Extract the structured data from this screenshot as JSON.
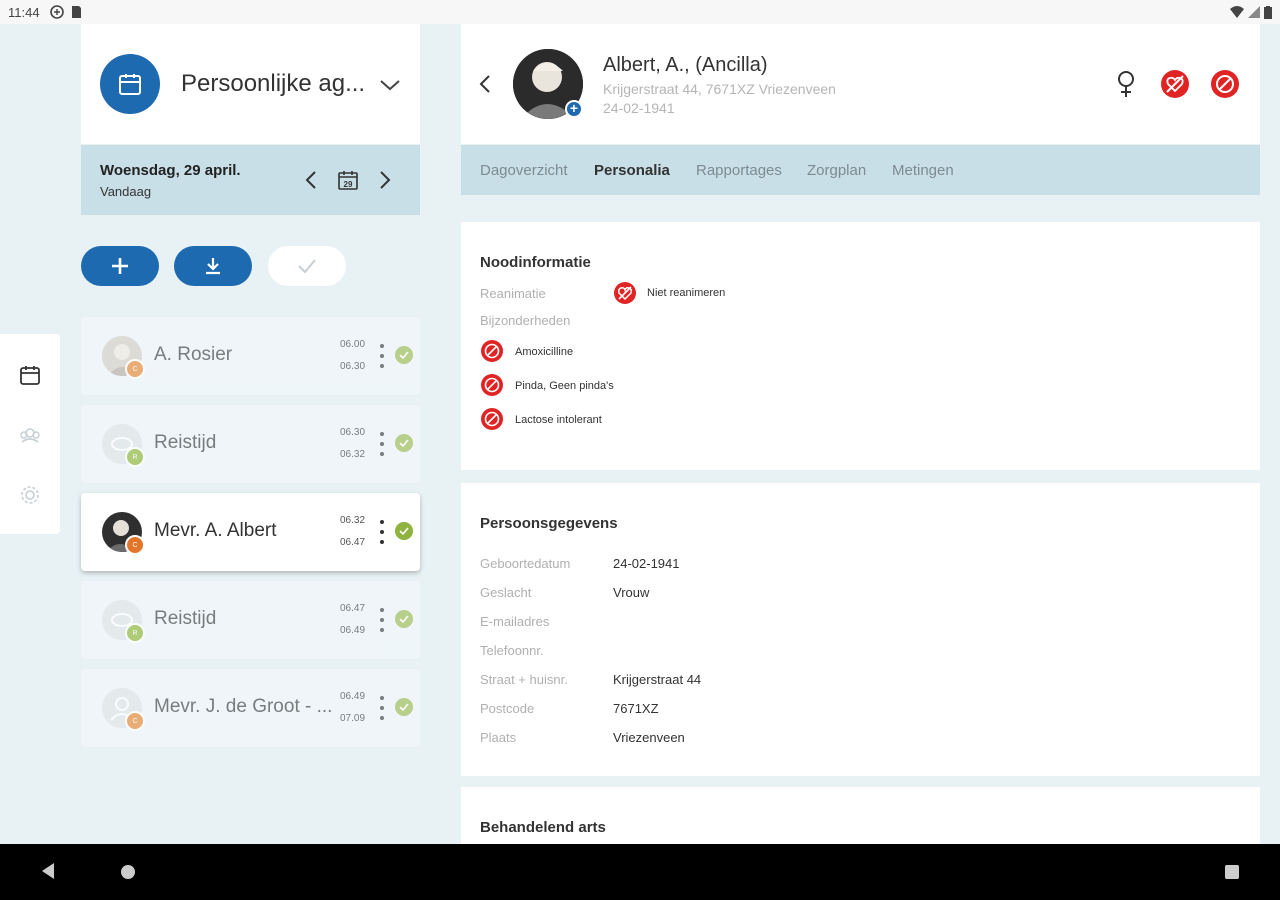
{
  "status_bar": {
    "time": "11:44"
  },
  "agenda": {
    "title": "Persoonlijke ag...",
    "date": "Woensdag, 29 april.",
    "date_sub": "Vandaag",
    "calendar_day": "29"
  },
  "appointments": [
    {
      "name": "A. Rosier",
      "start": "06.00",
      "end": "06.30",
      "badge": "C",
      "badge_color": "#e8954a",
      "kind": "photo"
    },
    {
      "name": "Reistijd",
      "start": "06.30",
      "end": "06.32",
      "badge": "R",
      "badge_color": "#9bbf4d",
      "kind": "travel"
    },
    {
      "name": "Mevr. A. Albert",
      "start": "06.32",
      "end": "06.47",
      "badge": "C",
      "badge_color": "#e2752a",
      "kind": "photo"
    },
    {
      "name": "Reistijd",
      "start": "06.47",
      "end": "06.49",
      "badge": "R",
      "badge_color": "#9bbf4d",
      "kind": "travel"
    },
    {
      "name": "Mevr. J. de Groot - ...",
      "start": "06.49",
      "end": "07.09",
      "badge": "C",
      "badge_color": "#e8954a",
      "kind": "person"
    }
  ],
  "patient": {
    "name": "Albert, A., (Ancilla)",
    "address": "Krijgerstraat 44, 7671XZ Vriezenveen",
    "dob": "24-02-1941"
  },
  "tabs": [
    "Dagoverzicht",
    "Personalia",
    "Rapportages",
    "Zorgplan",
    "Metingen"
  ],
  "noodinformatie": {
    "title": "Noodinformatie",
    "reanimatie_label": "Reanimatie",
    "reanimatie_value": "Niet reanimeren",
    "bijzonderheden_label": "Bijzonderheden",
    "items": [
      "Amoxicilline",
      "Pinda, Geen pinda's",
      "Lactose intolerant"
    ]
  },
  "persoonsgegevens": {
    "title": "Persoonsgegevens",
    "rows": [
      {
        "label": "Geboortedatum",
        "value": "24-02-1941"
      },
      {
        "label": "Geslacht",
        "value": "Vrouw"
      },
      {
        "label": "E-mailadres",
        "value": ""
      },
      {
        "label": "Telefoonnr.",
        "value": ""
      },
      {
        "label": "Straat + huisnr.",
        "value": "Krijgerstraat 44"
      },
      {
        "label": "Postcode",
        "value": "7671XZ"
      },
      {
        "label": "Plaats",
        "value": "Vriezenveen"
      }
    ]
  },
  "behandelend_arts": {
    "title": "Behandelend arts"
  },
  "colors": {
    "primary": "#1d6ab1",
    "alert_red": "#e02424",
    "check_green": "#a9c46a",
    "tab_bar": "#c9dfe7"
  }
}
